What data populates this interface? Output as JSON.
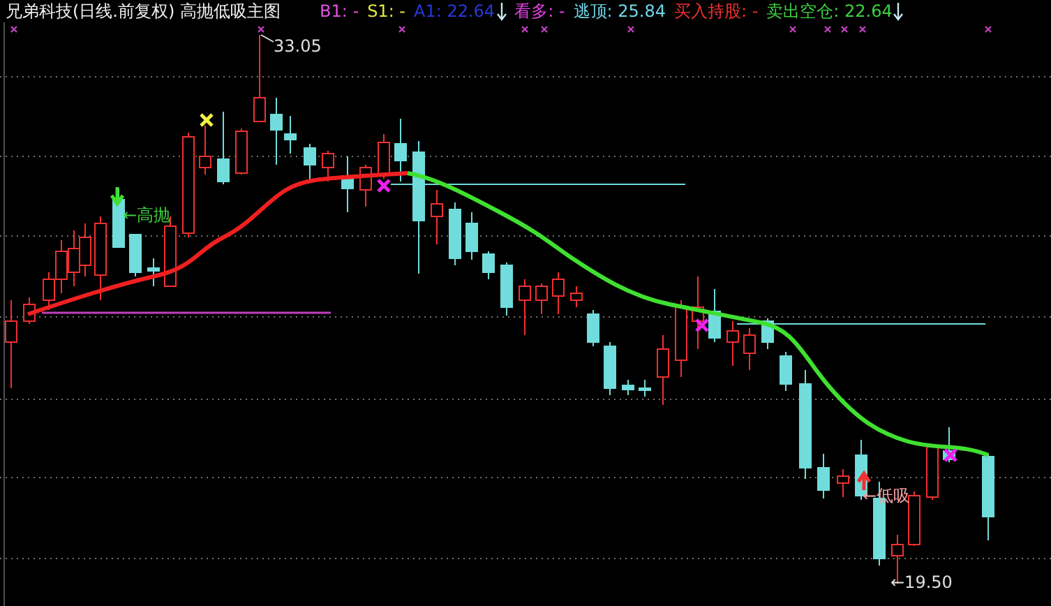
{
  "title": "兄弟科技(日线.前复权) 高抛低吸主图",
  "indicators": [
    {
      "text": "B1: -",
      "color": "#e050e0",
      "arrow": false
    },
    {
      "text": "S1: -",
      "color": "#e8e840",
      "arrow": false
    },
    {
      "text": "A1: 22.64",
      "color": "#2838d8",
      "arrow": true
    },
    {
      "text": "看多: -",
      "color": "#e040e0",
      "arrow": false
    },
    {
      "text": "逃顶: 25.84",
      "color": "#70d8e8",
      "arrow": false
    },
    {
      "text": "买入持股: -",
      "color": "#f03030",
      "arrow": false
    },
    {
      "text": "卖出空仓: 22.64",
      "color": "#40d040",
      "arrow": true
    }
  ],
  "annotations": [
    {
      "kind": "peak",
      "text": "33.05",
      "color": "#e0e0e0"
    },
    {
      "kind": "sell",
      "text": "←高抛",
      "color": "#40d040"
    },
    {
      "kind": "buy",
      "text": "←低吸",
      "color": "#f0a0a0"
    },
    {
      "kind": "trough",
      "text": "←19.50",
      "color": "#e0e0e0"
    }
  ]
}
